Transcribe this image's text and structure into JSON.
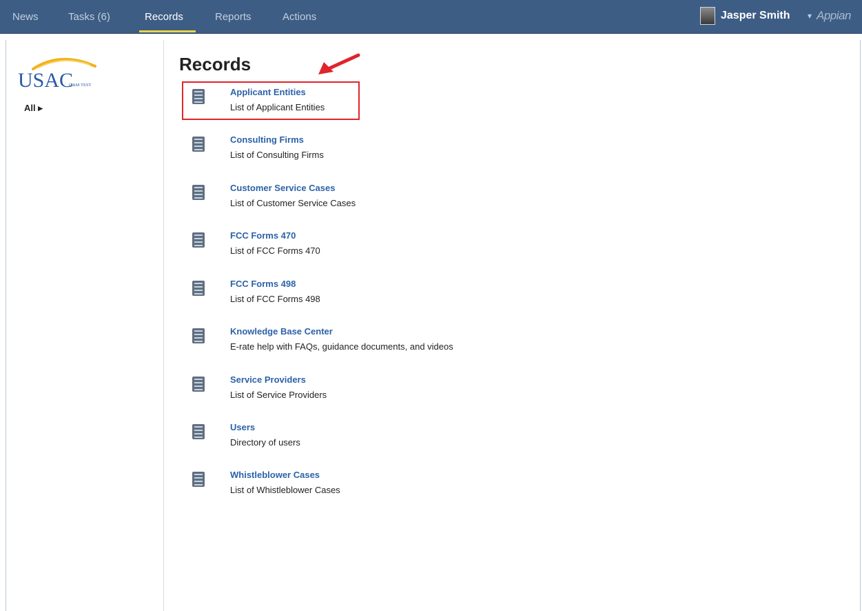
{
  "nav": {
    "tabs": [
      {
        "label": "News"
      },
      {
        "label": "Tasks (6)"
      },
      {
        "label": "Records"
      },
      {
        "label": "Reports"
      },
      {
        "label": "Actions"
      }
    ],
    "active_tab": "Records",
    "user_name": "Jasper Smith",
    "user_caret": "▾",
    "brand": "Appian"
  },
  "sidebar": {
    "logo_text": "USAC",
    "logo_subtext": "O&M TEST",
    "filter_label": "All ▸"
  },
  "main": {
    "title": "Records",
    "records": [
      {
        "title": "Applicant Entities",
        "description": "List of Applicant Entities"
      },
      {
        "title": "Consulting Firms",
        "description": "List of Consulting Firms"
      },
      {
        "title": "Customer Service Cases",
        "description": "List of Customer Service Cases"
      },
      {
        "title": "FCC Forms 470",
        "description": "List of FCC Forms 470"
      },
      {
        "title": "FCC Forms 498",
        "description": "List of FCC Forms 498"
      },
      {
        "title": "Knowledge Base Center",
        "description": "E-rate help with FAQs, guidance documents, and videos"
      },
      {
        "title": "Service Providers",
        "description": "List of Service Providers"
      },
      {
        "title": "Users",
        "description": "Directory of users"
      },
      {
        "title": "Whistleblower Cases",
        "description": "List of Whistleblower Cases"
      }
    ]
  },
  "colors": {
    "topbar": "#3d5d85",
    "link": "#2c62a8",
    "annotation": "#e0242b",
    "active_underline": "#e8d44a"
  },
  "icons": {
    "record": "record-type-icon",
    "annotation": "red-arrow-icon"
  }
}
